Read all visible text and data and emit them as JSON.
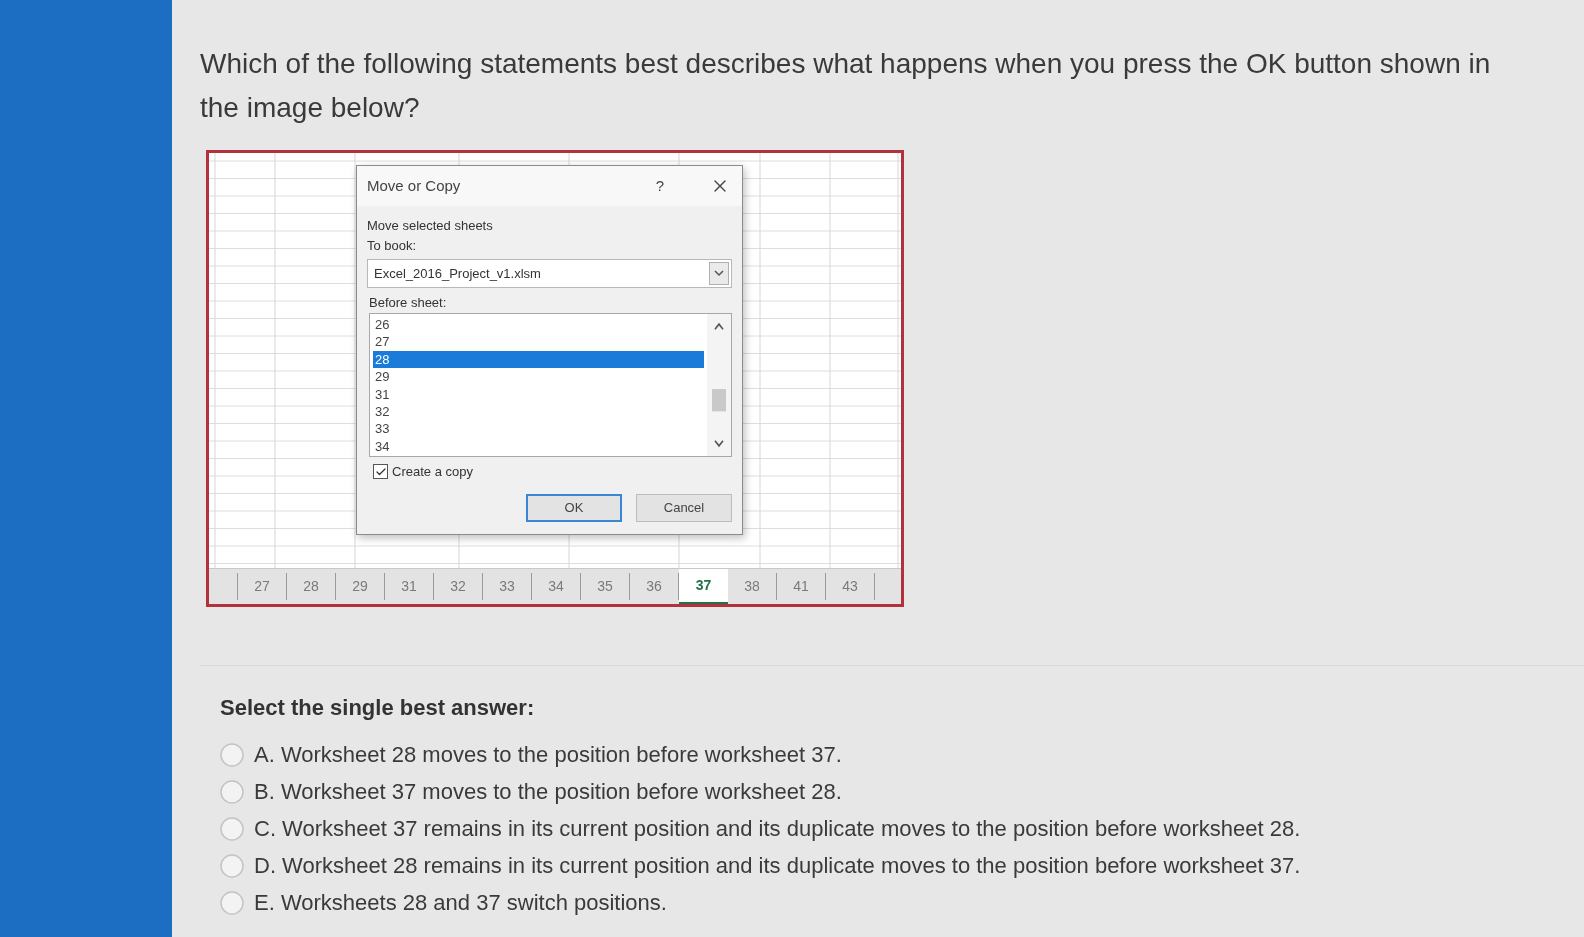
{
  "question": {
    "text": "Which of the following statements best describes what happens when you press the OK button shown in the image below?"
  },
  "figure": {
    "dialog": {
      "title": "Move or Copy",
      "help": "?",
      "section_label": "Move selected sheets",
      "to_book": {
        "label": "To book:",
        "value": "Excel_2016_Project_v1.xlsm"
      },
      "before_sheet": {
        "label": "Before sheet:",
        "items": [
          {
            "label": "26",
            "selected": false
          },
          {
            "label": "27",
            "selected": false
          },
          {
            "label": "28",
            "selected": true
          },
          {
            "label": "29",
            "selected": false
          },
          {
            "label": "31",
            "selected": false
          },
          {
            "label": "32",
            "selected": false
          },
          {
            "label": "33",
            "selected": false
          },
          {
            "label": "34",
            "selected": false
          }
        ]
      },
      "create_copy": {
        "label": "Create a copy",
        "checked": true
      },
      "buttons": [
        {
          "label": "OK",
          "default": true
        },
        {
          "label": "Cancel",
          "default": false
        }
      ]
    },
    "sheet_tabs": [
      {
        "label": "27",
        "selected": false
      },
      {
        "label": "28",
        "selected": false
      },
      {
        "label": "29",
        "selected": false
      },
      {
        "label": "31",
        "selected": false
      },
      {
        "label": "32",
        "selected": false
      },
      {
        "label": "33",
        "selected": false
      },
      {
        "label": "34",
        "selected": false
      },
      {
        "label": "35",
        "selected": false
      },
      {
        "label": "36",
        "selected": false
      },
      {
        "label": "37",
        "selected": true
      },
      {
        "label": "38",
        "selected": false
      },
      {
        "label": "41",
        "selected": false
      },
      {
        "label": "43",
        "selected": false
      }
    ]
  },
  "answers": {
    "heading": "Select the single best answer:",
    "options": [
      {
        "label": "A. Worksheet 28 moves to the position before worksheet 37.",
        "selected": false
      },
      {
        "label": "B. Worksheet 37 moves to the position before worksheet 28.",
        "selected": false
      },
      {
        "label": "C. Worksheet 37 remains in its current position and its duplicate moves to the position before worksheet 28.",
        "selected": false
      },
      {
        "label": "D. Worksheet 28 remains in its current position and its duplicate moves to the position before worksheet 37.",
        "selected": false
      },
      {
        "label": "E. Worksheets 28 and 37 switch positions.",
        "selected": false
      }
    ]
  }
}
